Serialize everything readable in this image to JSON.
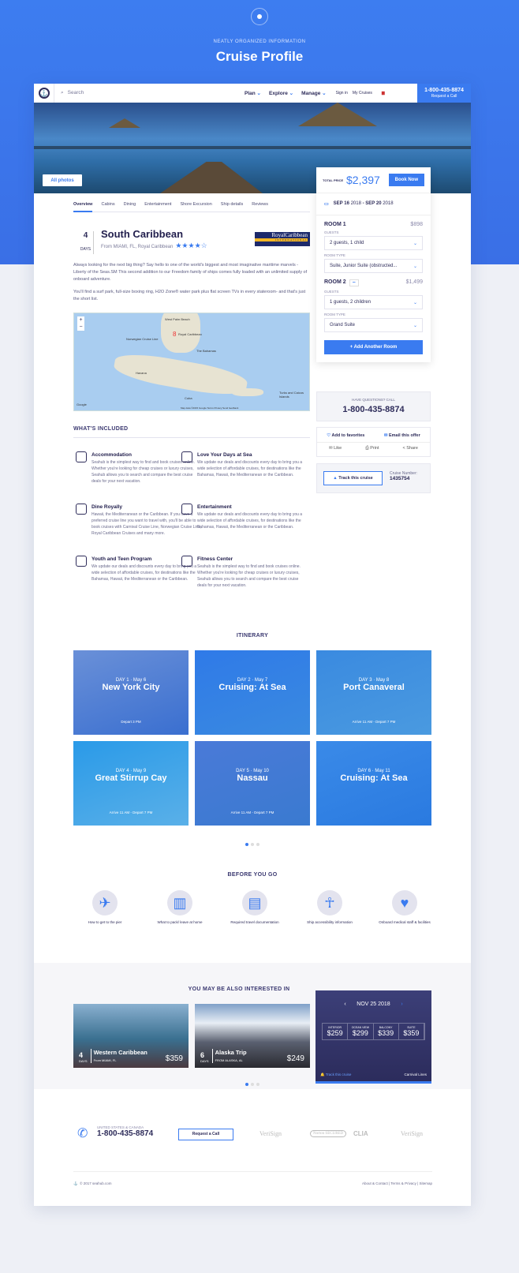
{
  "page": {
    "kicker": "NEATLY ORGANIZED INFORMATION",
    "title": "Cruise Profile"
  },
  "nav": {
    "search_placeholder": "Search",
    "menu": [
      "Plan",
      "Explore",
      "Manage"
    ],
    "sign_in": "Sign in",
    "my_cruises": "My Cruises",
    "phone": "1-800-435-8874",
    "request_call": "Request a Call"
  },
  "hero": {
    "all_photos": "All photos"
  },
  "tabs": [
    "Overview",
    "Cabins",
    "Dining",
    "Entertainment",
    "Shore Excursion",
    "Ship details",
    "Reviews"
  ],
  "cruise": {
    "days": "4",
    "days_label": "DAYS",
    "name": "South Caribbean",
    "from": "From MIAMI, FL, Royal Caribbean",
    "rating": 4,
    "rating_max": 5,
    "logo": "Royal Caribbean INTERNATIONAL",
    "desc": [
      "Always looking for the next big thing? Say hello to one of the world's biggest and most imaginative maritime marvels - Liberty of the Seas.SM This second addition to our Freedom family of ships comes fully loaded with an unlimited supply of onboard adventure.",
      "You'll find a surf park, full-size boxing ring, H2O Zone® water park plus flat screen TVs in every stateroom- and that's just the short list."
    ]
  },
  "map": {
    "labels": [
      "West Palm Beach",
      "Norwegian Cruise Line",
      "Royal Caribbean",
      "The Bahamas",
      "Havana",
      "Cuba",
      "Turks and Caicos Islands",
      "Google",
      "Map data ©2015 Google  Terms  Privacy  Send feedback"
    ]
  },
  "included": {
    "title": "WHAT'S INCLUDED",
    "items": [
      {
        "title": "Accommodation",
        "icon": "bed-icon",
        "text": "Seahub is the simplest way to find and book cruises online. Whether you're looking for cheap cruises or luxury cruises, Seahub allows you to search and compare the best cruise deals for your next vacation."
      },
      {
        "title": "Love Your Days at Sea",
        "icon": "ship-wheel-icon",
        "text": "We update our deals and discounts every day to bring you a wide selection of affordable cruises, for destinations like the Bahamas, Hawaii, the Mediterranean or the Caribbean."
      },
      {
        "title": "Dine Royally",
        "icon": "dining-icon",
        "text": "Hawaii, the Mediterranean or the Caribbean. If you have a preferred cruise line you want to travel with, you'll be able to book cruises with Carnival Cruise Line, Norwegian Cruise Line, Royal Caribbean Cruises and many more."
      },
      {
        "title": "Entertainment",
        "icon": "entertainment-icon",
        "text": "We update our deals and discounts every day to bring you a wide selection of affordable cruises, for destinations like the Bahamas, Hawaii, the Mediterranean or the Caribbean."
      },
      {
        "title": "Youth and Teen Program",
        "icon": "youth-icon",
        "text": "We update our deals and discounts every day to bring you a wide selection of affordable cruises, for destinations like the Bahamas, Hawaii, the Mediterranean or the Caribbean."
      },
      {
        "title": "Fitness Center",
        "icon": "dumbbell-icon",
        "text": "Seahub is the simplest way to find and book cruises online. Whether you're looking for cheap cruises or luxury cruises, Seahub allows you to search and compare the best cruise deals for your next vacation."
      }
    ]
  },
  "booking": {
    "total_label": "TOTAL PRICE",
    "total": "$2,397",
    "book_now": "Book Now",
    "date_start": "SEP 16",
    "year_start": "2018",
    "date_end": "SEP 20",
    "year_end": "2018",
    "guests_label": "GUESTS",
    "room_type_label": "ROOM TYPE",
    "rooms": [
      {
        "name": "ROOM 1",
        "price": "$898",
        "guests": "2 guests, 1 child",
        "type": "Suite, Junior Suite (obstructed..."
      },
      {
        "name": "ROOM 2",
        "price": "$1,499",
        "guests": "1 guests, 2 children",
        "type": "Grand Suite"
      }
    ],
    "add_room": "+ Add Another Room"
  },
  "questions": {
    "label": "HAVE QUESTIONS? CALL",
    "phone": "1-800-435-8874"
  },
  "actions": {
    "favorites": "Add to favorites",
    "email": "Email this offer",
    "like": "Like",
    "print": "Print",
    "share": "Share"
  },
  "track": {
    "button": "Track this cruise",
    "number_label": "Cruise Number:",
    "number": "1435754"
  },
  "itinerary": {
    "title": "ITINERARY",
    "days": [
      {
        "day": "DAY 1 · May 6",
        "name": "New York City",
        "time": "Depart 3 PM"
      },
      {
        "day": "DAY 2 · May 7",
        "name": "Cruising: At Sea",
        "time": ""
      },
      {
        "day": "DAY 3 · May 8",
        "name": "Port Canaveral",
        "time": "Arrive 11 AM - Depart 7 PM"
      },
      {
        "day": "DAY 4 · May 9",
        "name": "Great Stirrup Cay",
        "time": "Arrive 11 AM - Depart 7 PM"
      },
      {
        "day": "DAY 5 · May 10",
        "name": "Nassau",
        "time": "Arrive 11 AM - Depart 7 PM"
      },
      {
        "day": "DAY 6 · May 11",
        "name": "Cruising: At Sea",
        "time": ""
      }
    ]
  },
  "before": {
    "title": "BEFORE YOU GO",
    "items": [
      {
        "label": "How to get to the pier",
        "icon": "airplane-icon"
      },
      {
        "label": "What to pack/ leave at home",
        "icon": "luggage-icon"
      },
      {
        "label": "Required travel documentation",
        "icon": "passport-icon"
      },
      {
        "label": "Ship accessibility information",
        "icon": "accessibility-icon"
      },
      {
        "label": "Onboard medical staff & facilities",
        "icon": "heart-pulse-icon"
      }
    ]
  },
  "interested": {
    "title": "YOU MAY BE ALSO INTERESTED IN",
    "cards": [
      {
        "days": "4",
        "days_label": "DAYS",
        "name": "Western Caribbean",
        "from": "From MIAMI, FL",
        "price": "359"
      },
      {
        "days": "6",
        "days_label": "DAYS",
        "name": "Alaska Trip",
        "from": "FROM ALASKA, AL",
        "price": "249"
      }
    ],
    "featured": {
      "date": "NOV 25 2018",
      "prices": [
        {
          "label": "INTERIOR",
          "value": "259"
        },
        {
          "label": "OCEAN VIEW",
          "value": "299"
        },
        {
          "label": "BALCONY",
          "value": "339"
        },
        {
          "label": "SUITE",
          "value": "359"
        }
      ],
      "track": "Track this cruise",
      "line": "Carnival Lines"
    }
  },
  "footer": {
    "region": "UNITED STATES & CANADA",
    "phone": "1-800-435-8874",
    "request": "Request a Call",
    "badges": [
      "VeriSign",
      "Norton SECURED",
      "CLIA",
      "VeriSign"
    ],
    "copyright": "© 2017 seahub.com",
    "links": "About & Contact  |  Terms & Privacy  |  Sitemap"
  },
  "colors": {
    "accent": "#3a7bf0",
    "navy": "#2e2c5a"
  }
}
